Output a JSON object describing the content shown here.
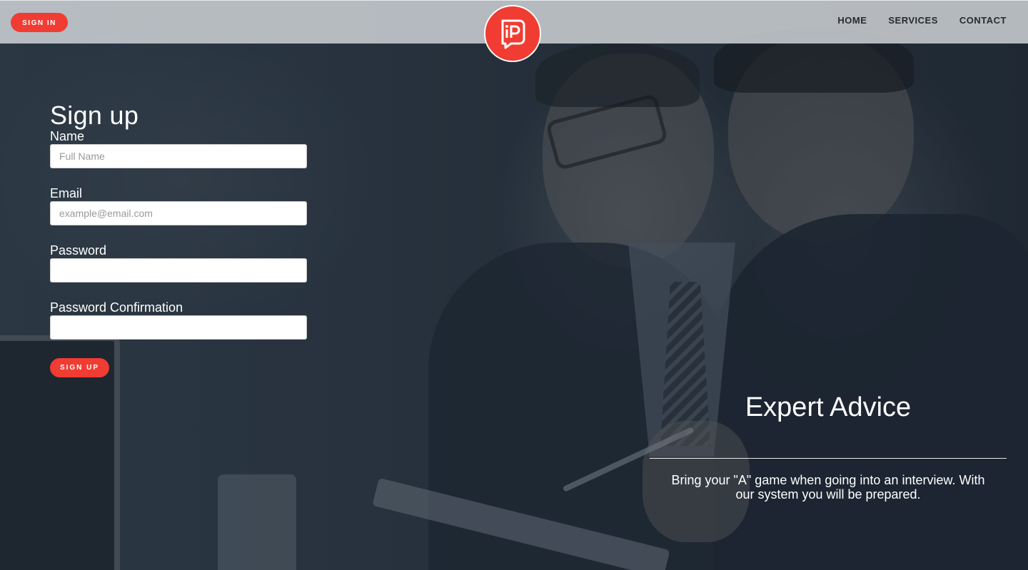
{
  "header": {
    "sign_in_label": "SIGN IN",
    "logo_icon": "ip-speech-bubble-logo-icon",
    "nav": [
      {
        "label": "HOME"
      },
      {
        "label": "SERVICES"
      },
      {
        "label": "CONTACT"
      }
    ]
  },
  "signup": {
    "title": "Sign up",
    "name_label": "Name",
    "name_placeholder": "Full Name",
    "email_label": "Email",
    "email_placeholder": "example@email.com",
    "password_label": "Password",
    "password_confirmation_label": "Password Confirmation",
    "submit_label": "SIGN UP"
  },
  "hero": {
    "title": "Expert Advice",
    "text": "Bring your \"A\" game when going into an interview. With our system you will be prepared."
  },
  "colors": {
    "accent": "#f03c32",
    "header_bg": "#d6d9dd",
    "nav_text": "#2a2a2a"
  }
}
